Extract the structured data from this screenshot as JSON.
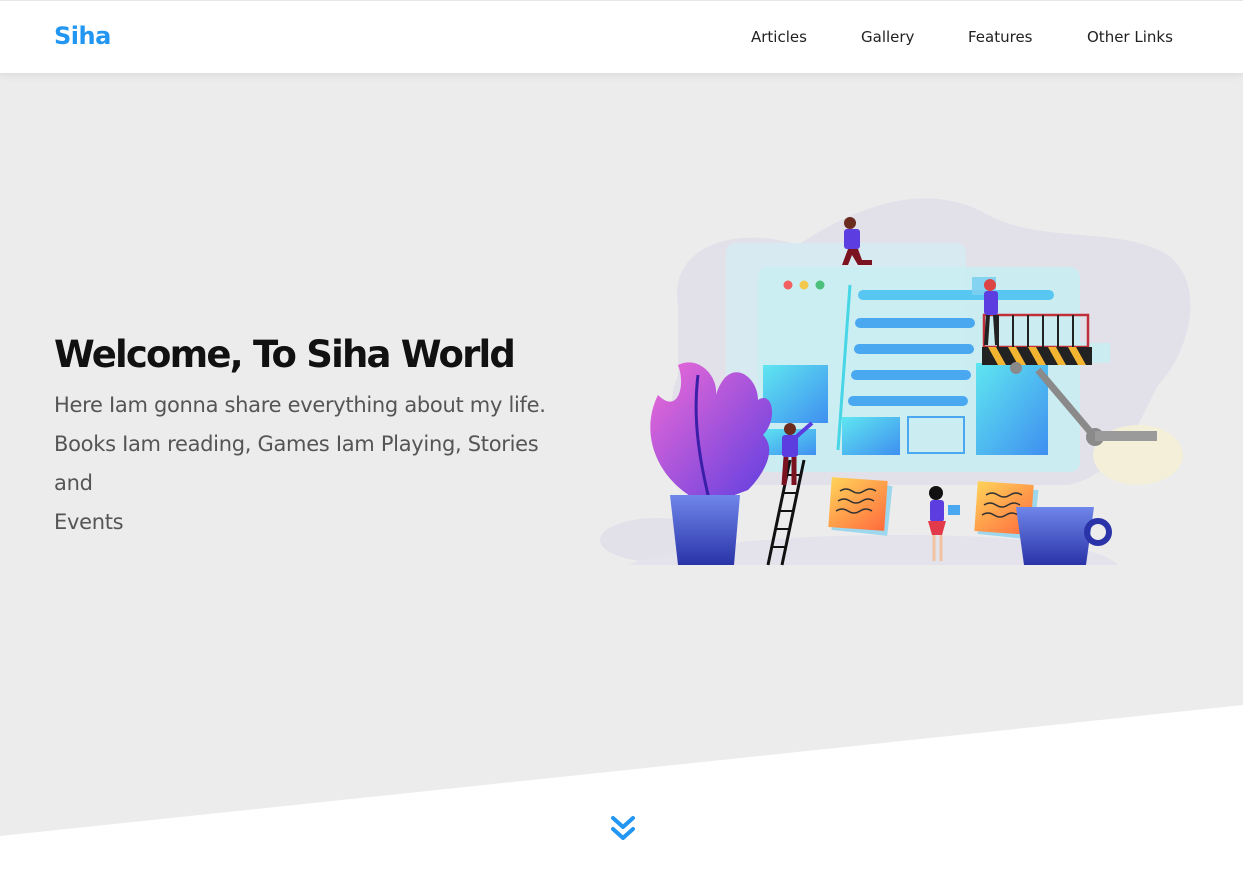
{
  "brand": "Siha",
  "nav": {
    "items": [
      {
        "label": "Articles"
      },
      {
        "label": "Gallery"
      },
      {
        "label": "Features"
      },
      {
        "label": "Other Links"
      }
    ]
  },
  "hero": {
    "title": "Welcome, To Siha World",
    "lines": [
      "Here Iam gonna share everything about my life.",
      "Books Iam reading, Games Iam Playing, Stories and",
      "Events"
    ]
  },
  "colors": {
    "accent": "#2196f3",
    "hero_bg": "#ececec",
    "text_dark": "#111111",
    "text_muted": "#555555"
  },
  "icons": {
    "scroll": "double-chevron-down-icon",
    "illustration": "web-construction-illustration"
  }
}
